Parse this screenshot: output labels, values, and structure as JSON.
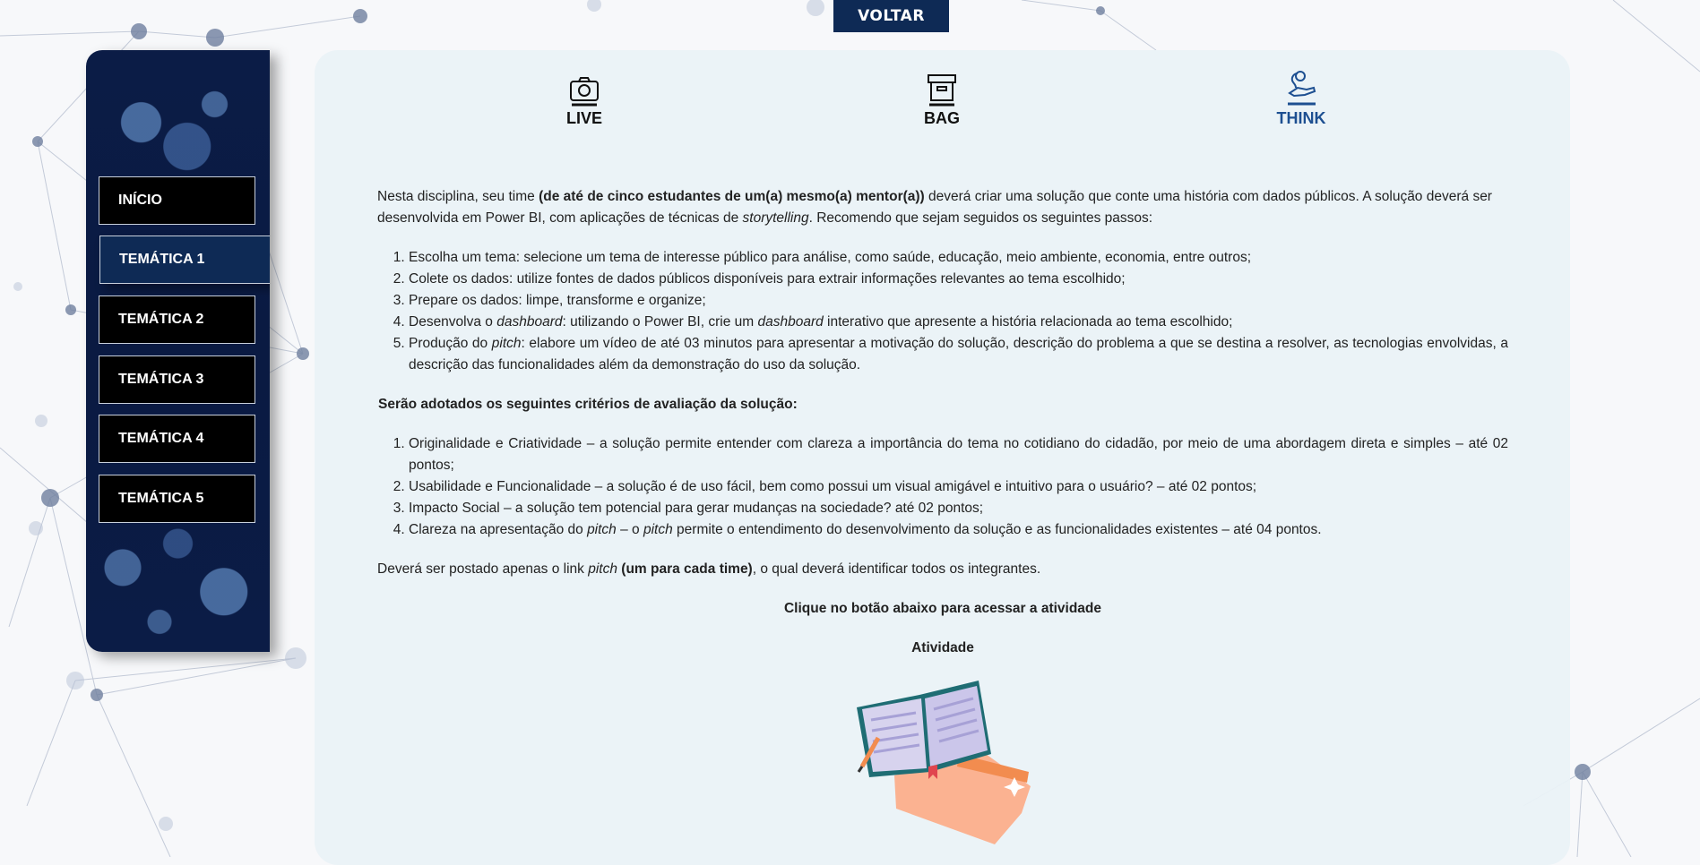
{
  "top": {
    "back_label": "VOLTAR"
  },
  "sidebar": {
    "items": [
      {
        "label": "INÍCIO"
      },
      {
        "label": "TEMÁTICA 1"
      },
      {
        "label": "TEMÁTICA 2"
      },
      {
        "label": "TEMÁTICA 3"
      },
      {
        "label": "TEMÁTICA 4"
      },
      {
        "label": "TEMÁTICA 5"
      }
    ],
    "active_index": 1
  },
  "tabs": [
    {
      "label": "LIVE",
      "icon": "camera-icon"
    },
    {
      "label": "BAG",
      "icon": "archive-box-icon"
    },
    {
      "label": "THINK",
      "icon": "lightbulb-hand-icon"
    }
  ],
  "content": {
    "intro": {
      "p1": "Nesta disciplina, seu time ",
      "p1_bold": "(de até de cinco estudantes de um(a) mesmo(a) mentor(a))",
      "p2": " deverá criar uma solução que conte uma história com dados públicos. A solução deverá ser desenvolvida em Power BI, com aplicações de técnicas de ",
      "p2_italic": "storytelling",
      "p3": ". Recomendo que sejam seguidos os seguintes passos:"
    },
    "steps": {
      "s1": "Escolha um tema: selecione um tema de interesse público para análise, como saúde, educação, meio ambiente, economia, entre outros;",
      "s2": "Colete os dados: utilize fontes de dados públicos disponíveis para extrair informações relevantes ao tema escolhido;",
      "s3": "Prepare os dados: limpe, transforme e organize;",
      "s4_a": "Desenvolva o ",
      "s4_i1": "dashboard",
      "s4_b": ": utilizando o Power BI, crie um ",
      "s4_i2": "dashboard",
      "s4_c": " interativo que apresente a história relacionada ao tema escolhido;",
      "s5_a": "Produção do ",
      "s5_i": "pitch",
      "s5_b": ": elabore um vídeo de até 03 minutos para apresentar a motivação do solução, descrição do problema a que se destina a resolver, as tecnologias envolvidas, a descrição das funcionalidades além da demonstração do uso da solução."
    },
    "criteria_title": "Serão adotados os seguintes critérios de avaliação da solução:",
    "criteria": {
      "c1": "Originalidade e Criatividade – a solução permite entender com clareza a importância do tema no cotidiano do cidadão, por meio de uma abordagem direta e simples – até 02 pontos;",
      "c2": "Usabilidade e Funcionalidade – a solução é de uso fácil, bem como possui um visual amigável e intuitivo para o usuário? – até 02 pontos;",
      "c3": "Impacto Social – a solução tem potencial para gerar mudanças na sociedade? até 02 pontos;",
      "c4_a": "Clareza na apresentação do ",
      "c4_i1": "pitch",
      "c4_b": " – o ",
      "c4_i2": "pitch",
      "c4_c": " permite o entendimento do desenvolvimento da solução e as funcionalidades existentes – até 04 pontos."
    },
    "post": {
      "a": "Deverá ser postado apenas o link ",
      "i": "pitch",
      "bold": " (um para cada time)",
      "b": ", o qual deverá identificar todos os integrantes."
    },
    "cta": "Clique no botão abaixo para acessar a atividade",
    "activity_label": "Atividade"
  },
  "colors": {
    "accent": "#0e2a55",
    "think_tab": "#1d4f91",
    "panel": "#eaf2f7"
  }
}
